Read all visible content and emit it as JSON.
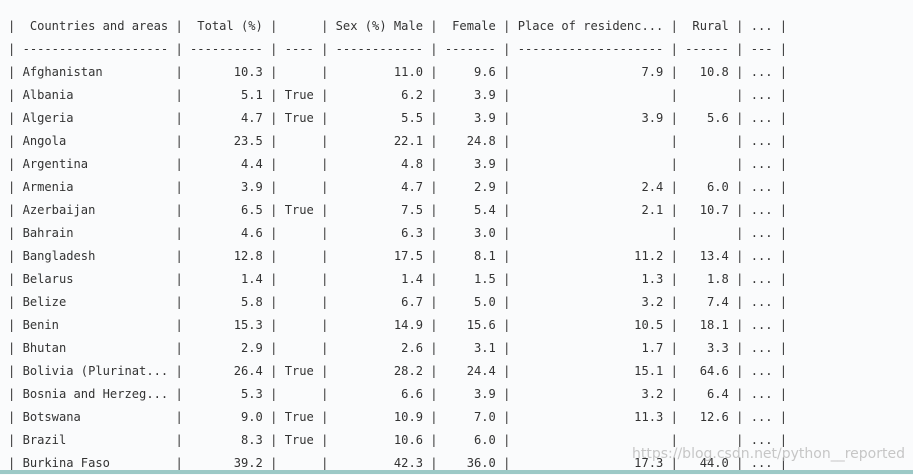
{
  "table": {
    "headers": [
      "Countries and areas",
      "Total (%)",
      "",
      "Sex (%) Male",
      "Female",
      "Place of residenc...",
      "Rural",
      "..."
    ],
    "rows": [
      [
        "Afghanistan",
        "10.3",
        "",
        "11.0",
        "9.6",
        "7.9",
        "10.8",
        "..."
      ],
      [
        "Albania",
        "5.1",
        "True",
        "6.2",
        "3.9",
        "",
        "",
        "..."
      ],
      [
        "Algeria",
        "4.7",
        "True",
        "5.5",
        "3.9",
        "3.9",
        "5.6",
        "..."
      ],
      [
        "Angola",
        "23.5",
        "",
        "22.1",
        "24.8",
        "",
        "",
        "..."
      ],
      [
        "Argentina",
        "4.4",
        "",
        "4.8",
        "3.9",
        "",
        "",
        "..."
      ],
      [
        "Armenia",
        "3.9",
        "",
        "4.7",
        "2.9",
        "2.4",
        "6.0",
        "..."
      ],
      [
        "Azerbaijan",
        "6.5",
        "True",
        "7.5",
        "5.4",
        "2.1",
        "10.7",
        "..."
      ],
      [
        "Bahrain",
        "4.6",
        "",
        "6.3",
        "3.0",
        "",
        "",
        "..."
      ],
      [
        "Bangladesh",
        "12.8",
        "",
        "17.5",
        "8.1",
        "11.2",
        "13.4",
        "..."
      ],
      [
        "Belarus",
        "1.4",
        "",
        "1.4",
        "1.5",
        "1.3",
        "1.8",
        "..."
      ],
      [
        "Belize",
        "5.8",
        "",
        "6.7",
        "5.0",
        "3.2",
        "7.4",
        "..."
      ],
      [
        "Benin",
        "15.3",
        "",
        "14.9",
        "15.6",
        "10.5",
        "18.1",
        "..."
      ],
      [
        "Bhutan",
        "2.9",
        "",
        "2.6",
        "3.1",
        "1.7",
        "3.3",
        "..."
      ],
      [
        "Bolivia (Plurinat...",
        "26.4",
        "True",
        "28.2",
        "24.4",
        "15.1",
        "64.6",
        "..."
      ],
      [
        "Bosnia and Herzeg...",
        "5.3",
        "",
        "6.6",
        "3.9",
        "3.2",
        "6.4",
        "..."
      ],
      [
        "Botswana",
        "9.0",
        "True",
        "10.9",
        "7.0",
        "11.3",
        "12.6",
        "..."
      ],
      [
        "Brazil",
        "8.3",
        "True",
        "10.6",
        "6.0",
        "",
        "",
        "..."
      ],
      [
        "Burkina Faso",
        "39.2",
        "",
        "42.3",
        "36.0",
        "17.3",
        "44.0",
        "..."
      ]
    ]
  },
  "watermark": "https://blog.csdn.net/python__reported"
}
